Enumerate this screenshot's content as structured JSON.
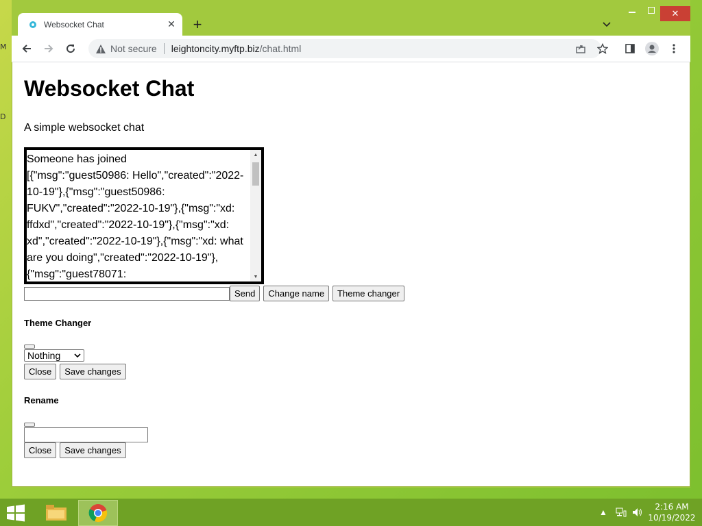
{
  "desktop": {
    "icon_label_1": "M",
    "icon_label_2": "D"
  },
  "browser": {
    "tab_title": "Websocket Chat",
    "security_label": "Not secure",
    "url_host": "leightoncity.myftp.biz",
    "url_path": "/chat.html"
  },
  "page": {
    "heading": "Websocket Chat",
    "subtitle": "A simple websocket chat",
    "chat_log": "Someone has joined\n[{\"msg\":\"guest50986: Hello\",\"created\":\"2022-10-19\"},{\"msg\":\"guest50986: FUKV\",\"created\":\"2022-10-19\"},{\"msg\":\"xd: ffdxd\",\"created\":\"2022-10-19\"},{\"msg\":\"xd: xd\",\"created\":\"2022-10-19\"},{\"msg\":\"xd: what are you doing\",\"created\":\"2022-10-19\"},{\"msg\":\"guest78071:",
    "message_input_value": "",
    "send_label": "Send",
    "change_name_label": "Change name",
    "theme_changer_label": "Theme changer",
    "theme_section_title": "Theme Changer",
    "theme_select_value": "Nothing",
    "close_label": "Close",
    "save_label": "Save changes",
    "rename_section_title": "Rename",
    "rename_input_value": ""
  },
  "taskbar": {
    "time": "2:16 AM",
    "date": "10/19/2022"
  },
  "colors": {
    "accent_close": "#c94034",
    "taskbar": "#6fa225"
  }
}
